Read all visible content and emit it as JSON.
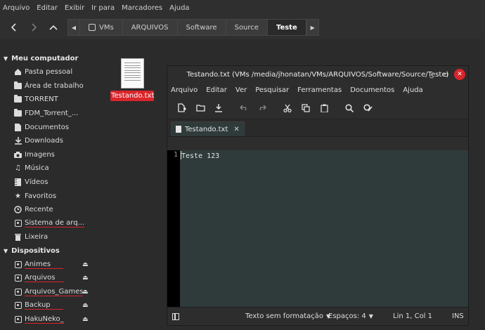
{
  "fm_menu": [
    "Arquivo",
    "Editar",
    "Exibir",
    "Ir para",
    "Marcadores",
    "Ajuda"
  ],
  "nav": {
    "back": "‹",
    "forward": "›",
    "up": "^"
  },
  "pathbar": [
    "VMs",
    "ARQUIVOS",
    "Software",
    "Source",
    "Teste"
  ],
  "sidebar": {
    "computer_header": "Meu computador",
    "computer_items": [
      {
        "label": "Pasta pessoal",
        "icon": "home-icon"
      },
      {
        "label": "Área de trabalho",
        "icon": "desktop-folder-icon"
      },
      {
        "label": "TORRENT",
        "icon": "folder-icon"
      },
      {
        "label": "FDM_Torrent_...",
        "icon": "folder-icon"
      },
      {
        "label": "Documentos",
        "icon": "document-icon"
      },
      {
        "label": "Downloads",
        "icon": "download-icon"
      },
      {
        "label": "Imagens",
        "icon": "camera-icon"
      },
      {
        "label": "Música",
        "icon": "music-icon"
      },
      {
        "label": "Vídeos",
        "icon": "video-icon"
      },
      {
        "label": "Favoritos",
        "icon": "star-icon"
      },
      {
        "label": "Recente",
        "icon": "clock-icon"
      },
      {
        "label": "Sistema de arq...",
        "icon": "drive-icon"
      },
      {
        "label": "Lixeira",
        "icon": "trash-icon"
      }
    ],
    "devices_header": "Dispositivos",
    "device_items": [
      {
        "label": "Animes"
      },
      {
        "label": "Arquivos"
      },
      {
        "label": "Arquivos_Games"
      },
      {
        "label": "Backup"
      },
      {
        "label": "HakuNeko_"
      }
    ]
  },
  "desktop_file": {
    "label": "Testando.txt"
  },
  "editor": {
    "title": "Testando.txt (VMs /media/jhonatan/VMs/ARQUIVOS/Software/Source/Teste)",
    "menu": [
      "Arquivo",
      "Editar",
      "Ver",
      "Pesquisar",
      "Ferramentas",
      "Documentos",
      "Ajuda"
    ],
    "tab_label": "Testando.txt",
    "line_number": "1",
    "content": "Teste 123",
    "status": {
      "syntax": "Texto sem formatação",
      "spaces": "Espaços: 4",
      "position": "Lin 1, Col 1",
      "mode": "INS"
    }
  },
  "colors": {
    "accent_red": "#d9252b",
    "editor_bg": "#2f3a3a"
  }
}
